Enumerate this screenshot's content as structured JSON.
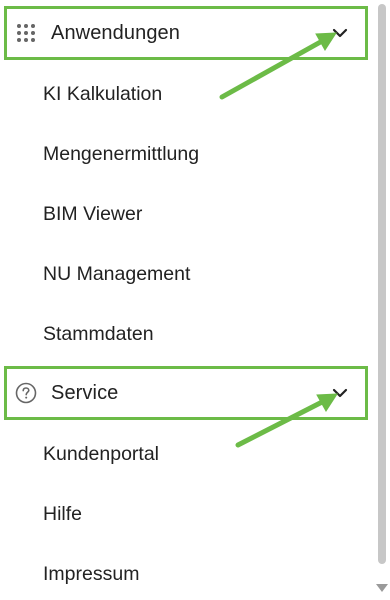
{
  "menu": {
    "sections": [
      {
        "label": "Anwendungen",
        "icon": "apps-grid-icon",
        "expand_icon": "chevron-down-icon",
        "items": [
          "KI Kalkulation",
          "Mengenermittlung",
          "BIM Viewer",
          "NU Management",
          "Stammdaten"
        ]
      },
      {
        "label": "Service",
        "icon": "help-circle-icon",
        "expand_icon": "chevron-down-icon",
        "items": [
          "Kundenportal",
          "Hilfe",
          "Impressum"
        ]
      }
    ]
  },
  "colors": {
    "highlight": "#6cbb47",
    "text": "#222222",
    "icon": "#666666"
  }
}
